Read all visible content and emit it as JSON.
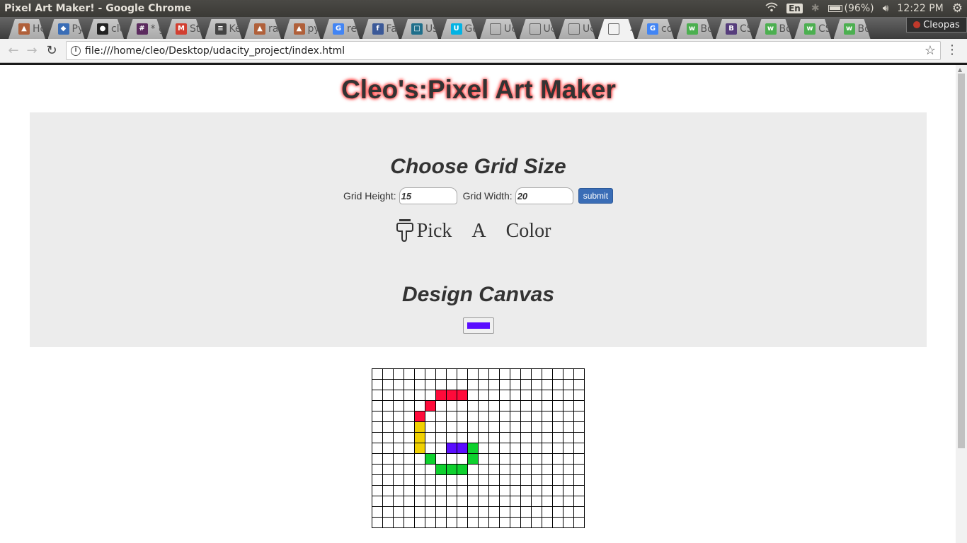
{
  "os": {
    "window_title": "Pixel Art Maker! - Google Chrome",
    "language": "En",
    "battery": "(96%)",
    "time": "12:22 PM"
  },
  "browser": {
    "tabs": [
      {
        "label": "Hc",
        "icon": "fire-icon",
        "color": "#b0603a"
      },
      {
        "label": "Py",
        "icon": "python-icon",
        "color": "#3a6db6"
      },
      {
        "label": "cle",
        "icon": "github-icon",
        "color": "#222222"
      },
      {
        "label": "* g",
        "icon": "slack-icon",
        "color": "#5b2a5e"
      },
      {
        "label": "Sta",
        "icon": "gmail-icon",
        "color": "#d23f31"
      },
      {
        "label": "Ke",
        "icon": "book-icon",
        "color": "#444444"
      },
      {
        "label": "ra",
        "icon": "fire-icon",
        "color": "#b0603a"
      },
      {
        "label": "py",
        "icon": "fire-icon",
        "color": "#b0603a"
      },
      {
        "label": "re",
        "icon": "google-icon",
        "color": "#4285f4"
      },
      {
        "label": "Fa",
        "icon": "facebook-icon",
        "color": "#3b5998"
      },
      {
        "label": "Us",
        "icon": "monitor-icon",
        "color": "#1f6f8b"
      },
      {
        "label": "Go",
        "icon": "udacity-icon",
        "color": "#02b3e4"
      },
      {
        "label": "Uc",
        "icon": "document-icon",
        "color": "#666666"
      },
      {
        "label": "Uc",
        "icon": "document-icon",
        "color": "#666666"
      },
      {
        "label": "Uc",
        "icon": "document-icon",
        "color": "#666666"
      },
      {
        "label": "",
        "icon": "document-icon",
        "color": "#666666",
        "active": true
      },
      {
        "label": "co",
        "icon": "google-icon",
        "color": "#4285f4"
      },
      {
        "label": "Bo",
        "icon": "w3schools-icon",
        "color": "#4caf50"
      },
      {
        "label": "CS",
        "icon": "bootstrap-icon",
        "color": "#563d7c"
      },
      {
        "label": "Bo",
        "icon": "w3schools-icon",
        "color": "#4caf50"
      },
      {
        "label": "CS",
        "icon": "w3schools-icon",
        "color": "#4caf50"
      },
      {
        "label": "Bo",
        "icon": "w3schools-icon",
        "color": "#4caf50"
      }
    ],
    "profile_name": "Cleopas",
    "url": "file:///home/cleo/Desktop/udacity_project/index.html"
  },
  "page": {
    "title": "Cleo's:Pixel Art Maker",
    "grid_heading": "Choose Grid Size",
    "height_label": "Grid Height:",
    "height_value": "15",
    "width_label": "Grid Width:",
    "width_value": "20",
    "submit_label": "submit",
    "pick_words": [
      "Pick",
      "A",
      "Color"
    ],
    "selected_color": "#5a0dff",
    "canvas_heading": "Design Canvas"
  },
  "canvas": {
    "rows": 15,
    "cols": 20,
    "colors": {
      "red": "#ff0a3a",
      "yellow": "#f0d000",
      "purple": "#5a0dff",
      "green": "#0ed12e"
    },
    "painted": [
      {
        "r": 2,
        "c": 6,
        "color": "red"
      },
      {
        "r": 2,
        "c": 7,
        "color": "red"
      },
      {
        "r": 2,
        "c": 8,
        "color": "red"
      },
      {
        "r": 3,
        "c": 5,
        "color": "red"
      },
      {
        "r": 4,
        "c": 4,
        "color": "red"
      },
      {
        "r": 5,
        "c": 4,
        "color": "yellow"
      },
      {
        "r": 6,
        "c": 4,
        "color": "yellow"
      },
      {
        "r": 7,
        "c": 4,
        "color": "yellow"
      },
      {
        "r": 7,
        "c": 7,
        "color": "purple"
      },
      {
        "r": 7,
        "c": 8,
        "color": "purple"
      },
      {
        "r": 7,
        "c": 9,
        "color": "green"
      },
      {
        "r": 8,
        "c": 5,
        "color": "green"
      },
      {
        "r": 8,
        "c": 9,
        "color": "green"
      },
      {
        "r": 9,
        "c": 6,
        "color": "green"
      },
      {
        "r": 9,
        "c": 7,
        "color": "green"
      },
      {
        "r": 9,
        "c": 8,
        "color": "green"
      }
    ]
  }
}
